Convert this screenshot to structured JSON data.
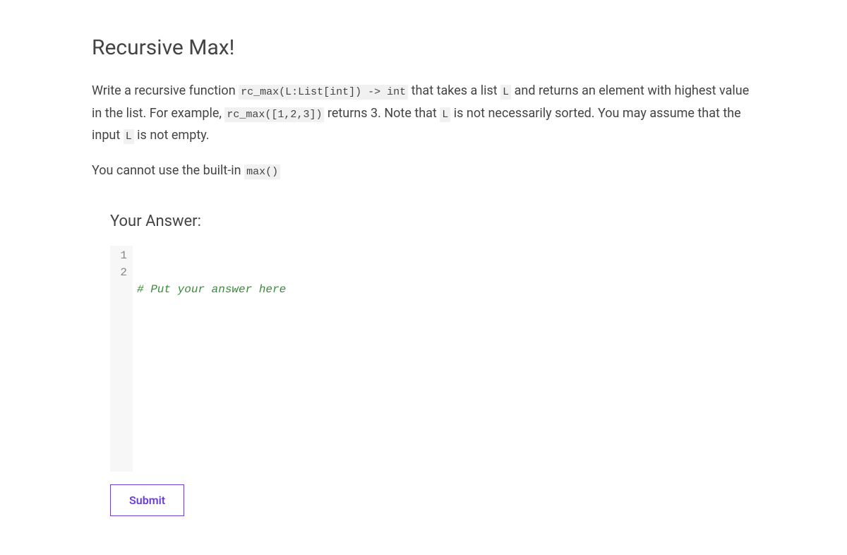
{
  "title": "Recursive Max!",
  "description": {
    "p1_pre": "Write a recursive function ",
    "p1_code1": "rc_max(L:List[int]) -> int",
    "p1_mid1": " that takes a list ",
    "p1_code2": "L",
    "p1_mid2": " and returns an element with highest value in the list. For example, ",
    "p1_code3": "rc_max([1,2,3])",
    "p1_mid3": " returns 3. Note that ",
    "p1_code4": "L",
    "p1_mid4": " is not necessarily sorted. You may assume that the input ",
    "p1_code5": "L",
    "p1_end": " is not empty.",
    "p2_pre": "You cannot use the built-in ",
    "p2_code1": "max()"
  },
  "answer": {
    "label": "Your Answer:",
    "lines": {
      "n1": "1",
      "n2": "2"
    },
    "code": {
      "line1": "# Put your answer here"
    }
  },
  "submit_label": "Submit"
}
